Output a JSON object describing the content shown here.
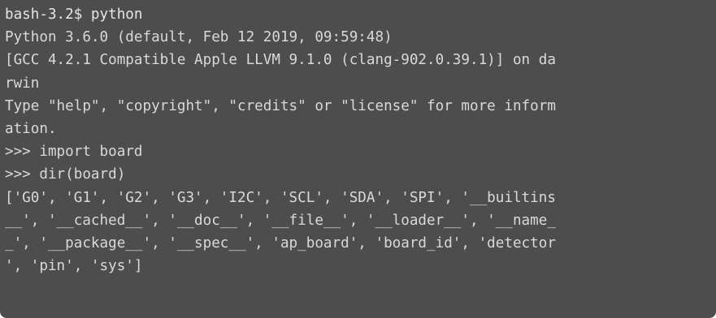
{
  "terminal": {
    "lines": [
      "bash-3.2$ python",
      "Python 3.6.0 (default, Feb 12 2019, 09:59:48)",
      "[GCC 4.2.1 Compatible Apple LLVM 9.1.0 (clang-902.0.39.1)] on da",
      "rwin",
      "Type \"help\", \"copyright\", \"credits\" or \"license\" for more inform",
      "ation.",
      ">>> import board",
      ">>> dir(board)",
      "['G0', 'G1', 'G2', 'G3', 'I2C', 'SCL', 'SDA', 'SPI', '__builtins",
      "__', '__cached__', '__doc__', '__file__', '__loader__', '__name_",
      "_', '__package__', '__spec__', 'ap_board', 'board_id', 'detector",
      "', 'pin', 'sys']"
    ],
    "colors": {
      "background": "#4d4d4d",
      "text": "#d9d9d9"
    }
  }
}
